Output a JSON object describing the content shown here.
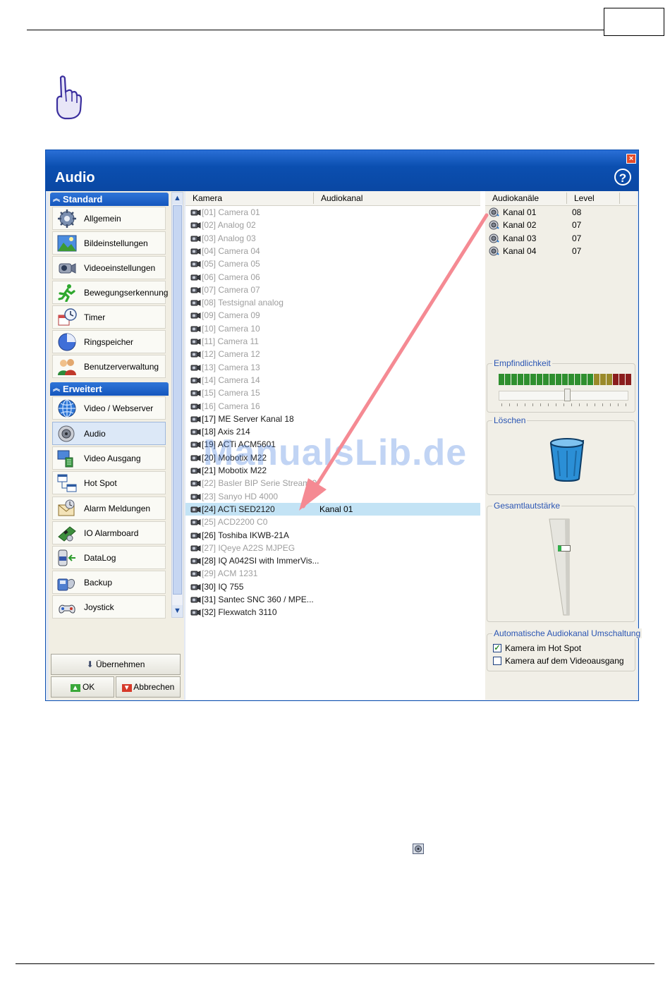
{
  "window": {
    "title": "Audio",
    "close_glyph": "×",
    "help_glyph": "?"
  },
  "sidebar": {
    "sections": [
      {
        "title": "Standard",
        "items": [
          {
            "label": "Allgemein",
            "icon": "gear-icon"
          },
          {
            "label": "Bildeinstellungen",
            "icon": "landscape-image-icon"
          },
          {
            "label": "Videoeinstellungen",
            "icon": "video-camera-icon"
          },
          {
            "label": "Bewegungserkennung",
            "icon": "running-man-icon"
          },
          {
            "label": "Timer",
            "icon": "clock-calendar-icon"
          },
          {
            "label": "Ringspeicher",
            "icon": "ring-storage-icon"
          },
          {
            "label": "Benutzerverwaltung",
            "icon": "users-icon"
          }
        ]
      },
      {
        "title": "Erweitert",
        "items": [
          {
            "label": "Video / Webserver",
            "icon": "globe-icon"
          },
          {
            "label": "Audio",
            "icon": "speaker-icon",
            "active": true
          },
          {
            "label": "Video Ausgang",
            "icon": "monitor-output-icon"
          },
          {
            "label": "Hot Spot",
            "icon": "hot-spot-icon"
          },
          {
            "label": "Alarm Meldungen",
            "icon": "alarm-mail-icon"
          },
          {
            "label": "IO Alarmboard",
            "icon": "io-board-icon"
          },
          {
            "label": "DataLog",
            "icon": "data-log-icon"
          },
          {
            "label": "Backup",
            "icon": "backup-icon"
          },
          {
            "label": "Joystick",
            "icon": "joystick-icon"
          }
        ]
      }
    ],
    "apply_button": "Übernehmen",
    "ok_button": "OK",
    "cancel_button": "Abbrechen"
  },
  "camera_table": {
    "columns": [
      "Kamera",
      "Audiokanal"
    ],
    "rows": [
      {
        "name": "[01] Camera 01",
        "enabled": false,
        "audio": ""
      },
      {
        "name": "[02] Analog 02",
        "enabled": false,
        "audio": ""
      },
      {
        "name": "[03] Analog 03",
        "enabled": false,
        "audio": ""
      },
      {
        "name": "[04] Camera 04",
        "enabled": false,
        "audio": ""
      },
      {
        "name": "[05] Camera 05",
        "enabled": false,
        "audio": ""
      },
      {
        "name": "[06] Camera 06",
        "enabled": false,
        "audio": ""
      },
      {
        "name": "[07] Camera 07",
        "enabled": false,
        "audio": ""
      },
      {
        "name": "[08] Testsignal analog",
        "enabled": false,
        "audio": ""
      },
      {
        "name": "[09] Camera 09",
        "enabled": false,
        "audio": ""
      },
      {
        "name": "[10] Camera 10",
        "enabled": false,
        "audio": ""
      },
      {
        "name": "[11] Camera 11",
        "enabled": false,
        "audio": ""
      },
      {
        "name": "[12] Camera 12",
        "enabled": false,
        "audio": ""
      },
      {
        "name": "[13] Camera 13",
        "enabled": false,
        "audio": ""
      },
      {
        "name": "[14] Camera 14",
        "enabled": false,
        "audio": ""
      },
      {
        "name": "[15] Camera 15",
        "enabled": false,
        "audio": ""
      },
      {
        "name": "[16] Camera 16",
        "enabled": false,
        "audio": ""
      },
      {
        "name": "[17] ME Server Kanal 18",
        "enabled": true,
        "audio": ""
      },
      {
        "name": "[18] Axis 214",
        "enabled": true,
        "audio": ""
      },
      {
        "name": "[19] ACTi ACM5601",
        "enabled": true,
        "audio": ""
      },
      {
        "name": "[20] Mobotix M22",
        "enabled": true,
        "audio": ""
      },
      {
        "name": "[21] Mobotix M22",
        "enabled": true,
        "audio": ""
      },
      {
        "name": "[22] Basler BIP Serie Stream 0",
        "enabled": false,
        "audio": ""
      },
      {
        "name": "[23] Sanyo HD 4000",
        "enabled": false,
        "audio": ""
      },
      {
        "name": "[24] ACTi SED2120",
        "enabled": true,
        "audio": "Kanal 01",
        "selected": true
      },
      {
        "name": "[25] ACD2200 C0",
        "enabled": false,
        "audio": ""
      },
      {
        "name": "[26] Toshiba IKWB-21A",
        "enabled": true,
        "audio": ""
      },
      {
        "name": "[27] IQeye A22S MJPEG",
        "enabled": false,
        "audio": ""
      },
      {
        "name": "[28] IQ A042SI with ImmerVis...",
        "enabled": true,
        "audio": ""
      },
      {
        "name": "[29] ACM 1231",
        "enabled": false,
        "audio": ""
      },
      {
        "name": "[30] IQ 755",
        "enabled": true,
        "audio": ""
      },
      {
        "name": "[31] Santec SNC 360 / MPE...",
        "enabled": true,
        "audio": ""
      },
      {
        "name": "[32] Flexwatch 3110",
        "enabled": true,
        "audio": ""
      }
    ]
  },
  "audio_channels": {
    "columns": [
      "Audiokanäle",
      "Level"
    ],
    "rows": [
      {
        "name": "Kanal 01",
        "level": "08"
      },
      {
        "name": "Kanal 02",
        "level": "07"
      },
      {
        "name": "Kanal 03",
        "level": "07"
      },
      {
        "name": "Kanal 04",
        "level": "07"
      }
    ]
  },
  "sensitivity": {
    "title": "Empfindlichkeit",
    "slider_value": 0.53
  },
  "delete_group": {
    "title": "Löschen",
    "icon": "trash-bin-icon"
  },
  "volume": {
    "title": "Gesamtlautstärke",
    "value": 0.73
  },
  "auto_switch": {
    "title": "Automatische Audiokanal Umschaltung",
    "options": [
      {
        "label": "Kamera im Hot Spot",
        "checked": true
      },
      {
        "label": "Kamera auf dem Videoausgang",
        "checked": false
      }
    ]
  },
  "watermark": "ManualsLib.de",
  "colors": {
    "title_bar": "#0b4fb0",
    "selected_row": "#c3e3f5",
    "annotation_arrow": "#f58a93",
    "group_title": "#2a55b3"
  }
}
